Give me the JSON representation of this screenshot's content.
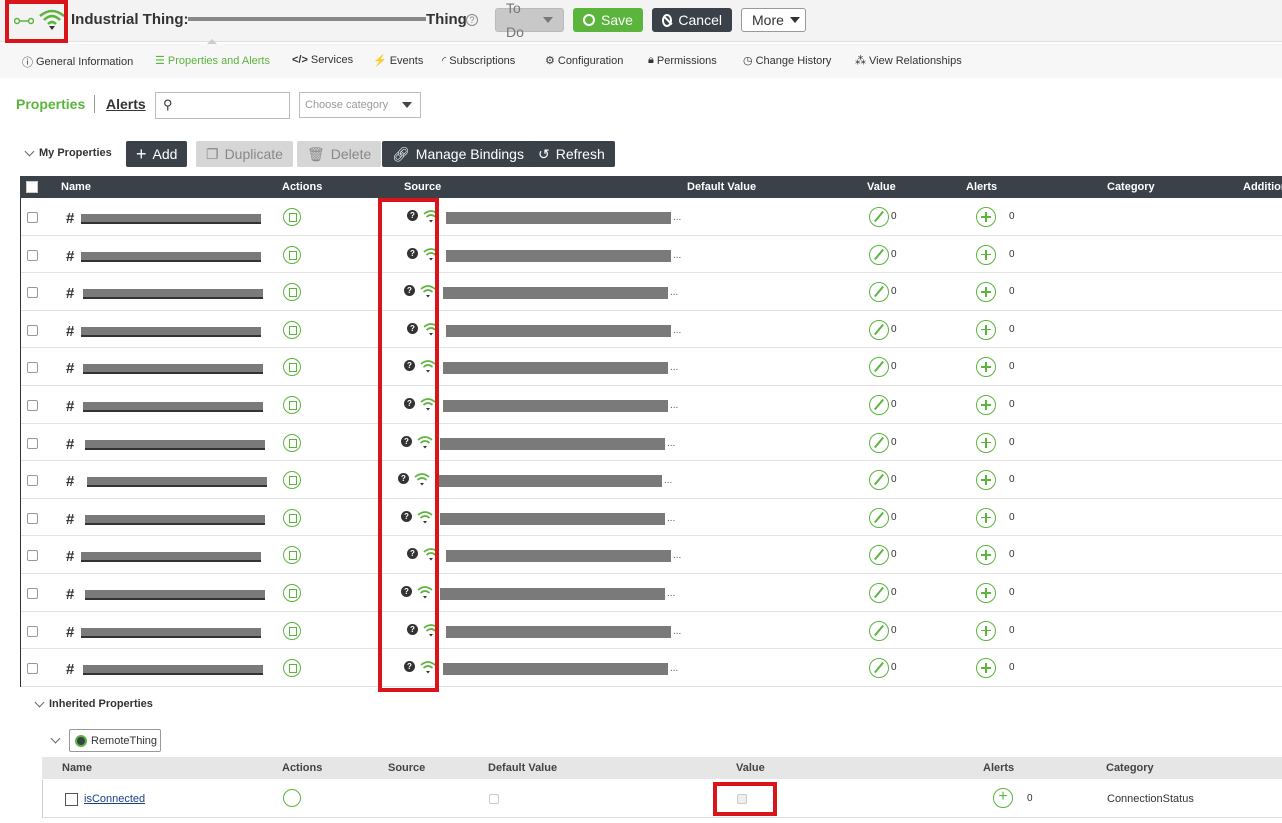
{
  "header": {
    "title_prefix": "Industrial Thing:",
    "title_suffix": "Thing",
    "help": "?",
    "todo_label": "To Do",
    "save_label": "Save",
    "cancel_label": "Cancel",
    "more_label": "More"
  },
  "tabs": [
    {
      "label": "General Information",
      "icon": "info-icon"
    },
    {
      "label": "Properties and Alerts",
      "icon": "list-icon",
      "active": true
    },
    {
      "label": "Services",
      "icon": "code-icon"
    },
    {
      "label": "Events",
      "icon": "bolt-icon"
    },
    {
      "label": "Subscriptions",
      "icon": "rss-icon"
    },
    {
      "label": "Configuration",
      "icon": "gear-icon"
    },
    {
      "label": "Permissions",
      "icon": "lock-icon"
    },
    {
      "label": "Change History",
      "icon": "clock-icon"
    },
    {
      "label": "View Relationships",
      "icon": "relationship-icon"
    }
  ],
  "subnav": {
    "properties": "Properties",
    "alerts": "Alerts",
    "search_placeholder": "",
    "category_placeholder": "Choose category"
  },
  "my_properties": {
    "label": "My Properties",
    "add": "Add",
    "duplicate": "Duplicate",
    "delete": "Delete",
    "manage_bindings": "Manage Bindings",
    "refresh": "Refresh"
  },
  "grid": {
    "columns": [
      "Name",
      "Actions",
      "Source",
      "Default Value",
      "Value",
      "Alerts",
      "Category",
      "Addition"
    ],
    "rows": [
      {
        "value": "0",
        "alerts": "0"
      },
      {
        "value": "0",
        "alerts": "0"
      },
      {
        "value": "0",
        "alerts": "0"
      },
      {
        "value": "0",
        "alerts": "0"
      },
      {
        "value": "0",
        "alerts": "0"
      },
      {
        "value": "0",
        "alerts": "0"
      },
      {
        "value": "0",
        "alerts": "0"
      },
      {
        "value": "0",
        "alerts": "0"
      },
      {
        "value": "0",
        "alerts": "0"
      },
      {
        "value": "0",
        "alerts": "0"
      },
      {
        "value": "0",
        "alerts": "0"
      },
      {
        "value": "0",
        "alerts": "0"
      },
      {
        "value": "0",
        "alerts": "0"
      }
    ],
    "source_ellipsis": "..."
  },
  "inherited": {
    "label": "Inherited Properties",
    "template": "RemoteThing",
    "columns": [
      "Name",
      "Actions",
      "Source",
      "Default Value",
      "Value",
      "Alerts",
      "Category"
    ],
    "row": {
      "name": "isConnected",
      "alerts": "0",
      "category": "ConnectionStatus"
    }
  },
  "colors": {
    "accent": "#5bb43c",
    "dark": "#3a4148",
    "highlight": "#d9141b"
  }
}
